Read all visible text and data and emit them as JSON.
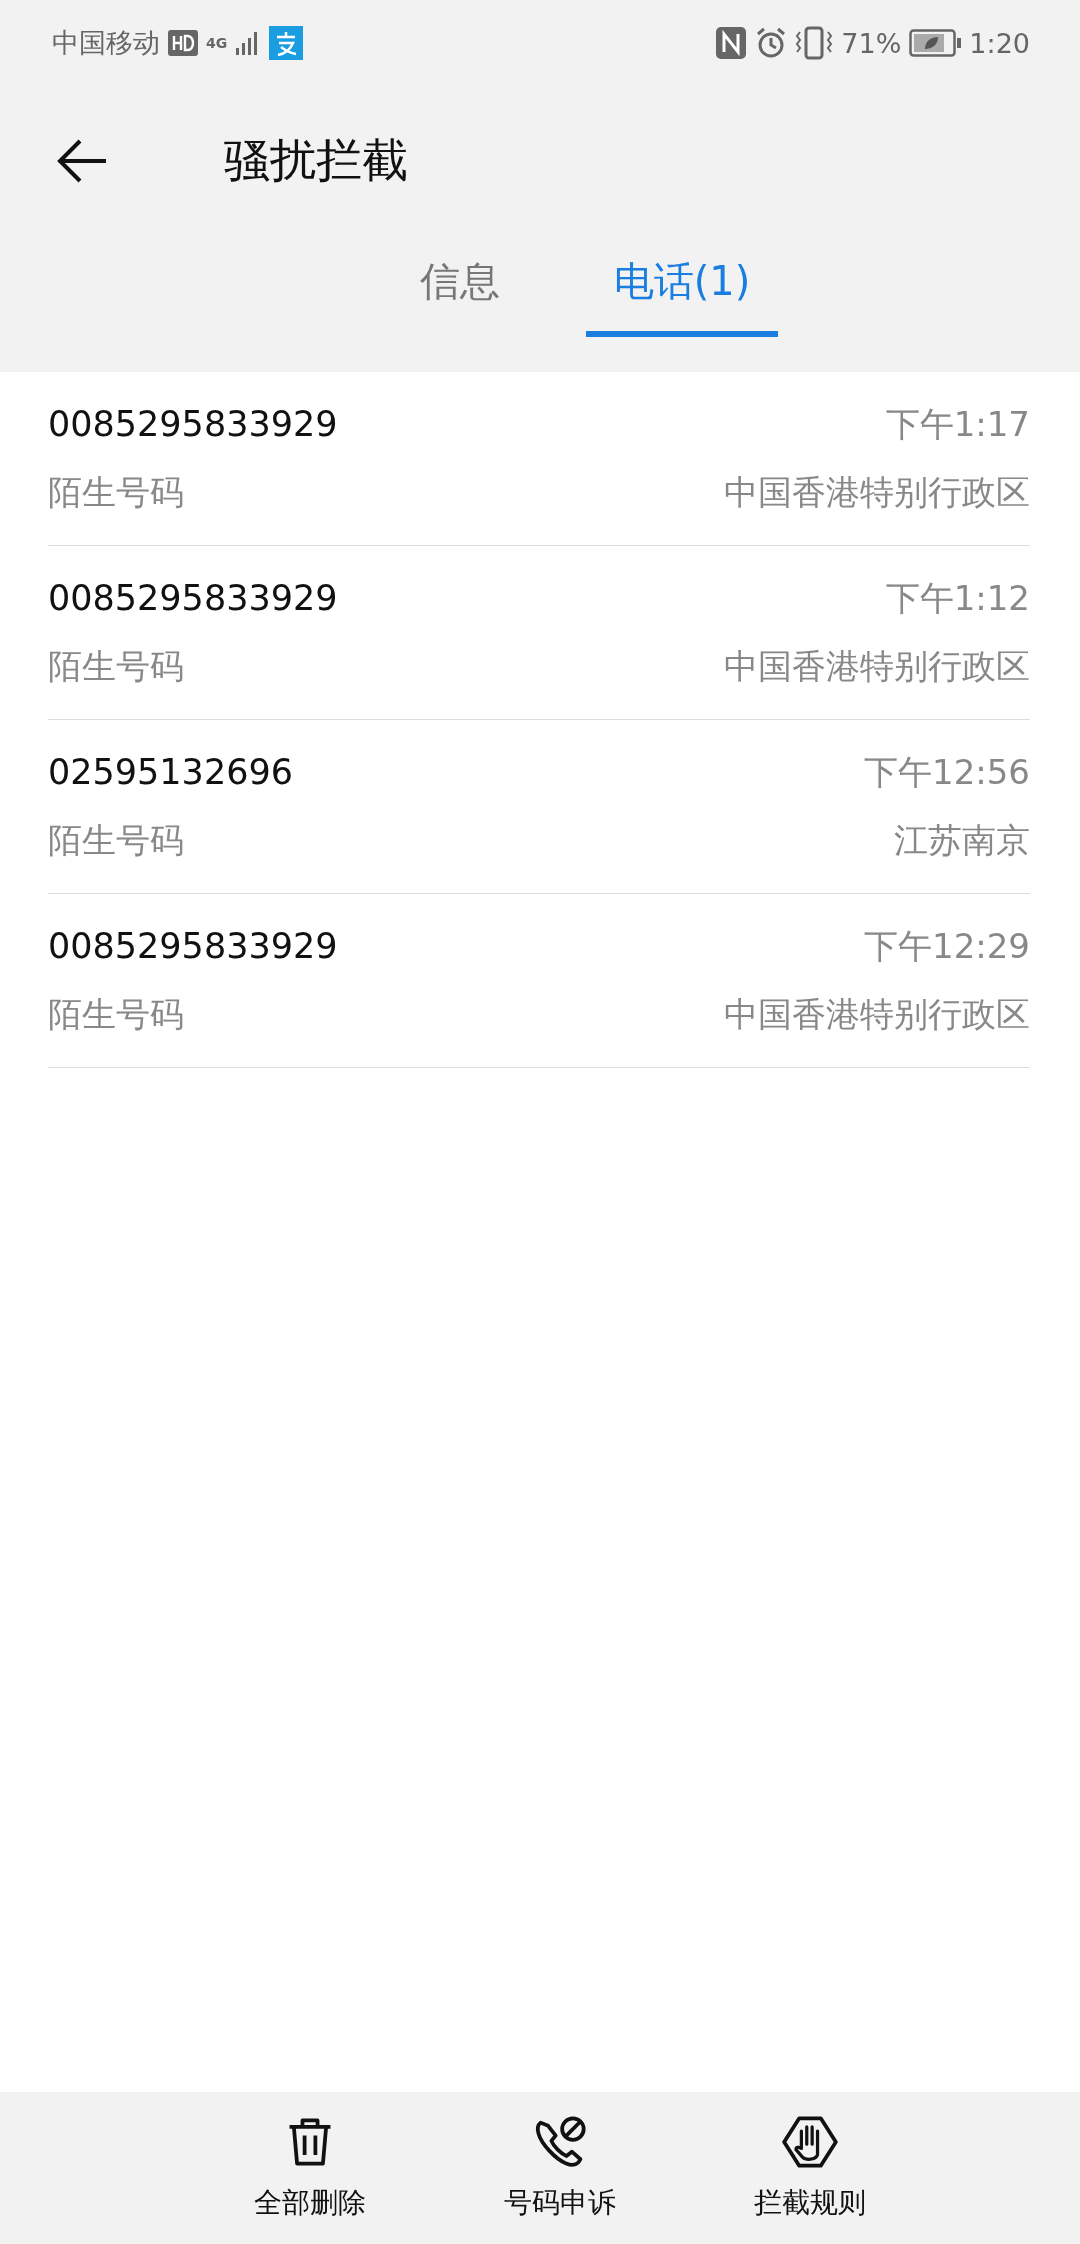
{
  "status_bar": {
    "carrier": "中国移动",
    "network": "4G",
    "battery_percent": "71%",
    "time": "1:20"
  },
  "header": {
    "title": "骚扰拦截"
  },
  "tabs": [
    {
      "label": "信息",
      "selected": false
    },
    {
      "label": "电话(1)",
      "selected": true
    }
  ],
  "calls": [
    {
      "number": "0085295833929",
      "label": "陌生号码",
      "time": "下午1:17",
      "location": "中国香港特别行政区"
    },
    {
      "number": "0085295833929",
      "label": "陌生号码",
      "time": "下午1:12",
      "location": "中国香港特别行政区"
    },
    {
      "number": "02595132696",
      "label": "陌生号码",
      "time": "下午12:56",
      "location": "江苏南京"
    },
    {
      "number": "0085295833929",
      "label": "陌生号码",
      "time": "下午12:29",
      "location": "中国香港特别行政区"
    }
  ],
  "actions": [
    {
      "kind": "trash",
      "label": "全部删除"
    },
    {
      "kind": "phone-block",
      "label": "号码申诉"
    },
    {
      "kind": "hand",
      "label": "拦截规则"
    }
  ]
}
